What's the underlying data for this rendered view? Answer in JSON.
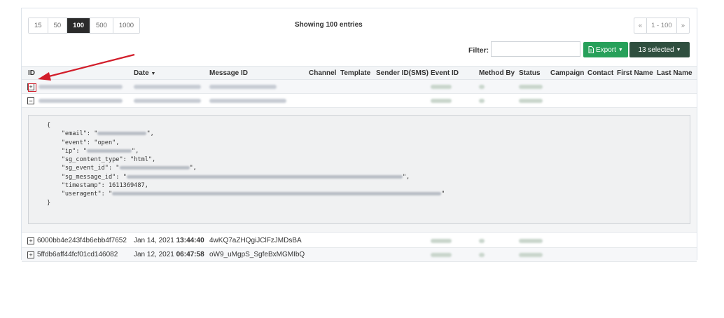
{
  "pager": {
    "sizes": [
      "15",
      "50",
      "100",
      "500",
      "1000"
    ],
    "active": "100"
  },
  "status_text": "Showing 100 entries",
  "pagination": {
    "prev": "«",
    "range": "1 - 100",
    "next": "»"
  },
  "filter": {
    "label": "Filter:",
    "value": ""
  },
  "export_label": "Export",
  "selected_label": "13 selected",
  "columns": [
    "ID",
    "Date",
    "Message ID",
    "Channel",
    "Template",
    "Sender ID(SMS)",
    "Event ID",
    "Method By",
    "Status",
    "Campaign",
    "Contact",
    "First Name",
    "Last Name"
  ],
  "rows": [
    {
      "id": "6000bb4e243f4b6ebb4f7652",
      "date": "Jan 14, 2021",
      "time": "13:44:40",
      "message_id": "4wKQ7aZHQgiJClFzJMDsBA"
    },
    {
      "id": "5ffdb6aff44fcf01cd146082",
      "date": "Jan 12, 2021",
      "time": "06:47:58",
      "message_id": "oW9_uMgpS_SgfeBxMGMIbQ"
    }
  ],
  "json_keys": {
    "open_brace": "{",
    "email": "\"email\": \"",
    "event": "\"event\": \"open\",",
    "ip": "\"ip\": \"",
    "sg_content_type": "\"sg_content_type\": \"html\",",
    "sg_event_id": "\"sg_event_id\": \"",
    "sg_message_id": "\"sg_message_id\": \"",
    "timestamp": "\"timestamp\": 1611369487,",
    "useragent": "\"useragent\": \"",
    "close_brace": "}"
  },
  "colors": {
    "export_green": "#27a05a",
    "selected_dark": "#2f4f3f",
    "annotation_red": "#d21d2a"
  },
  "icons": [
    "plus-square-icon",
    "minus-square-icon",
    "file-icon",
    "caret-down-icon",
    "sort-desc-icon",
    "red-arrow-annotation"
  ]
}
